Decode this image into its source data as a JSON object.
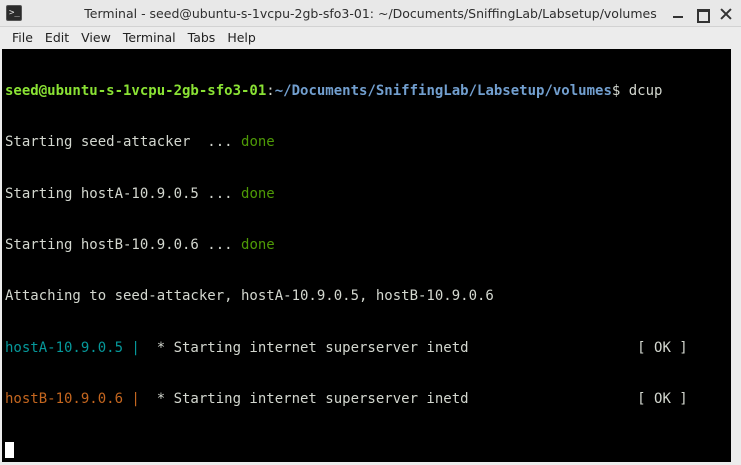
{
  "window": {
    "title": "Terminal - seed@ubuntu-s-1vcpu-2gb-sfo3-01: ~/Documents/SniffingLab/Labsetup/volumes",
    "icon_glyph": ">_"
  },
  "menubar": {
    "items": [
      "File",
      "Edit",
      "View",
      "Terminal",
      "Tabs",
      "Help"
    ]
  },
  "terminal": {
    "prompt_user": "seed@ubuntu-s-1vcpu-2gb-sfo3-01",
    "prompt_sep": ":",
    "prompt_path": "~/Documents/SniffingLab/Labsetup/volumes",
    "prompt_symbol": "$ ",
    "command": "dcup",
    "start_lines": [
      {
        "text": "Starting seed-attacker  ... ",
        "status": "done"
      },
      {
        "text": "Starting hostA-10.9.0.5 ... ",
        "status": "done"
      },
      {
        "text": "Starting hostB-10.9.0.6 ... ",
        "status": "done"
      }
    ],
    "attaching": "Attaching to seed-attacker, hostA-10.9.0.5, hostB-10.9.0.6",
    "log_lines": [
      {
        "prefix": "hostA-10.9.0.5 |",
        "message": "  * Starting internet superserver inetd                    [ OK ]"
      },
      {
        "prefix": "hostB-10.9.0.6 |",
        "message": "  * Starting internet superserver inetd                    [ OK ]"
      }
    ]
  },
  "colors": {
    "terminal_bg": "#000000",
    "prompt_user": "#8ae234",
    "prompt_path": "#729fcf",
    "done": "#4e9a06",
    "hostA": "#06989a",
    "hostB": "#c4661f"
  }
}
